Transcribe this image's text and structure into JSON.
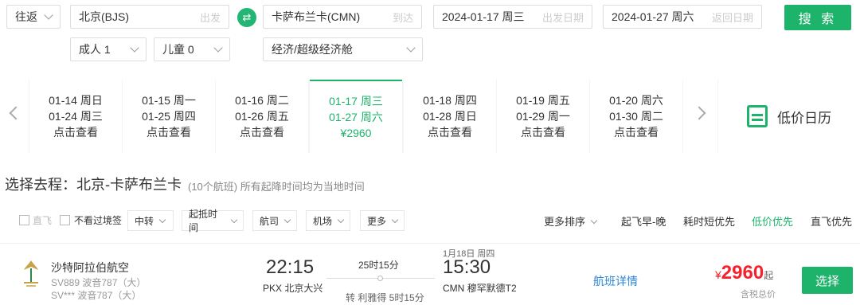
{
  "search": {
    "trip_type": "往返",
    "from_value": "北京(BJS)",
    "from_hint": "出发",
    "to_value": "卡萨布兰卡(CMN)",
    "to_hint": "到达",
    "depart_date": "2024-01-17 周三",
    "depart_hint": "出发日期",
    "return_date": "2024-01-27 周六",
    "return_hint": "返回日期",
    "search_label": "搜 索",
    "adults": "成人 1",
    "children": "儿童 0",
    "cabin": "经济/超级经济舱",
    "swap_glyph": "⇄"
  },
  "date_strip": {
    "cells": [
      {
        "depart": "01-14 周日",
        "return": "01-24 周三",
        "price": "点击查看"
      },
      {
        "depart": "01-15 周一",
        "return": "01-25 周四",
        "price": "点击查看"
      },
      {
        "depart": "01-16 周二",
        "return": "01-26 周五",
        "price": "点击查看"
      },
      {
        "depart": "01-17 周三",
        "return": "01-27 周六",
        "price": "¥2960"
      },
      {
        "depart": "01-18 周四",
        "return": "01-28 周日",
        "price": "点击查看"
      },
      {
        "depart": "01-19 周五",
        "return": "01-29 周一",
        "price": "点击查看"
      },
      {
        "depart": "01-20 周六",
        "return": "01-30 周二",
        "price": "点击查看"
      }
    ],
    "calendar_label": "低价日历"
  },
  "results": {
    "title": "选择去程：北京-卡萨布兰卡",
    "subtitle": "(10个航班) 所有起降时间均为当地时间"
  },
  "filters": {
    "direct": "直飞",
    "no_transit_visa": "不看过境签",
    "dropdowns": [
      "中转",
      "起抵时间",
      "航司",
      "机场",
      "更多"
    ],
    "more_sort": "更多排序",
    "sorts": [
      "起飞早-晚",
      "耗时短优先",
      "低价优先",
      "直飞优先"
    ],
    "active_sort": "低价优先"
  },
  "flight": {
    "airline": "沙特阿拉伯航空",
    "flight_line1": "SV889 波音787（大）",
    "flight_line2": "SV***  波音787（大）",
    "depart_time": "22:15",
    "depart_airport": "PKX 北京大兴",
    "duration": "25时15分",
    "transfer": "转 利雅得 5时15分",
    "arrive_date": "1月18日 周四",
    "arrive_time": "15:30",
    "arrive_airport": "CMN 穆罕默德T2",
    "detail_link": "航班详情",
    "price_symbol": "¥",
    "price": "2960",
    "price_unit": "起",
    "tax_note": "含税总价",
    "select_label": "选择"
  },
  "colors": {
    "brand": "#1db36b",
    "price": "#f5222d",
    "link": "#2a86d8"
  }
}
